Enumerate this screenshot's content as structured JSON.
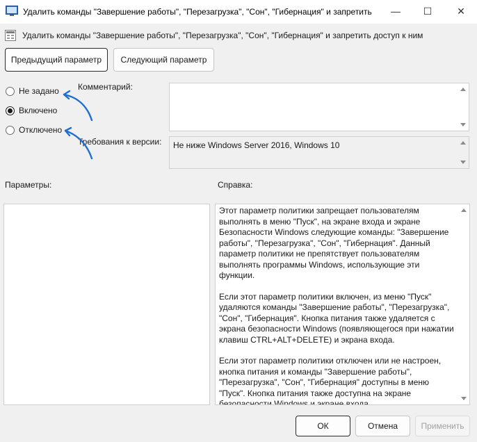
{
  "window": {
    "title": "Удалить команды \"Завершение работы\", \"Перезагрузка\", \"Сон\", \"Гибернация\" и запретить",
    "controls": {
      "minimize": "—",
      "maximize": "☐",
      "close": "✕"
    }
  },
  "header": {
    "policy_title": "Удалить команды \"Завершение работы\", \"Перезагрузка\", \"Сон\", \"Гибернация\" и запретить доступ к ним"
  },
  "nav": {
    "prev_label": "Предыдущий параметр",
    "next_label": "Следующий параметр"
  },
  "state": {
    "options": [
      {
        "label": "Не задано",
        "checked": false
      },
      {
        "label": "Включено",
        "checked": true
      },
      {
        "label": "Отключено",
        "checked": false
      }
    ]
  },
  "comment": {
    "label": "Комментарий:",
    "value": ""
  },
  "requirements": {
    "label": "Требования к версии:",
    "value": "Не ниже Windows Server 2016, Windows 10"
  },
  "options_panel": {
    "label": "Параметры:"
  },
  "help": {
    "label": "Справка:",
    "paragraphs": [
      "Этот параметр политики запрещает пользователям выполнять в меню \"Пуск\", на экране входа и экране Безопасности Windows следующие команды: \"Завершение работы\", \"Перезагрузка\", \"Сон\", \"Гибернация\". Данный параметр политики не препятствует пользователям выполнять программы Windows, использующие эти функции.",
      "Если этот параметр политики включен, из меню \"Пуск\" удаляются команды \"Завершение работы\", \"Перезагрузка\", \"Сон\", \"Гибернация\". Кнопка питания также удаляется с экрана безопасности Windows (появляющегося при нажатии клавиш CTRL+ALT+DELETE) и экрана входа.",
      "Если этот параметр политики отключен или не настроен, кнопка питания и команды \"Завершение работы\", \"Перезагрузка\", \"Сон\", \"Гибернация\" доступны в меню \"Пуск\". Кнопка питания также доступна на экране безопасности Windows и экране входа."
    ]
  },
  "footer": {
    "ok_label": "ОК",
    "cancel_label": "Отмена",
    "apply_label": "Применить"
  },
  "colors": {
    "annotation_arrow": "#1f6fd1",
    "default_button_border": "#2a2a2a"
  }
}
